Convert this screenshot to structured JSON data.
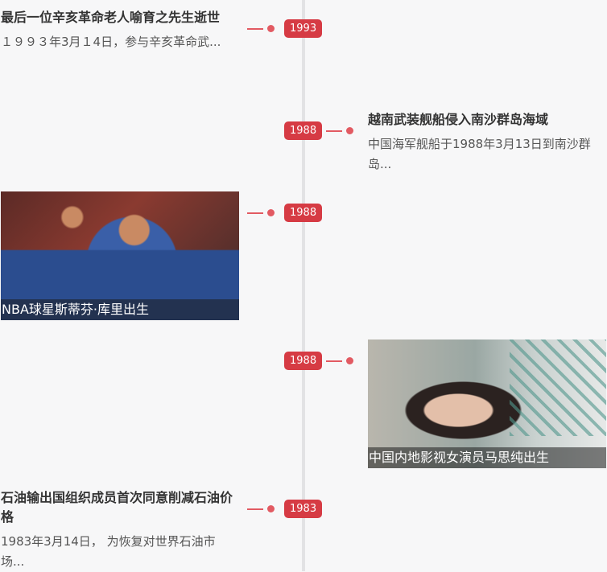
{
  "events": [
    {
      "year": "1993",
      "title": "最后一位辛亥革命老人喻育之先生逝世",
      "desc": "１９９３年3月１4日，参与辛亥革命武..."
    },
    {
      "year": "1988",
      "title": "越南武装舰船侵入南沙群岛海域",
      "desc": "中国海军舰船于1988年3月13日到南沙群岛..."
    },
    {
      "year": "1988",
      "caption": "NBA球星斯蒂芬·库里出生"
    },
    {
      "year": "1988",
      "caption": "中国内地影视女演员马思纯出生"
    },
    {
      "year": "1983",
      "title": "石油输出国组织成员首次同意削减石油价格",
      "desc": "1983年3月14日， 为恢复对世界石油市场..."
    }
  ]
}
